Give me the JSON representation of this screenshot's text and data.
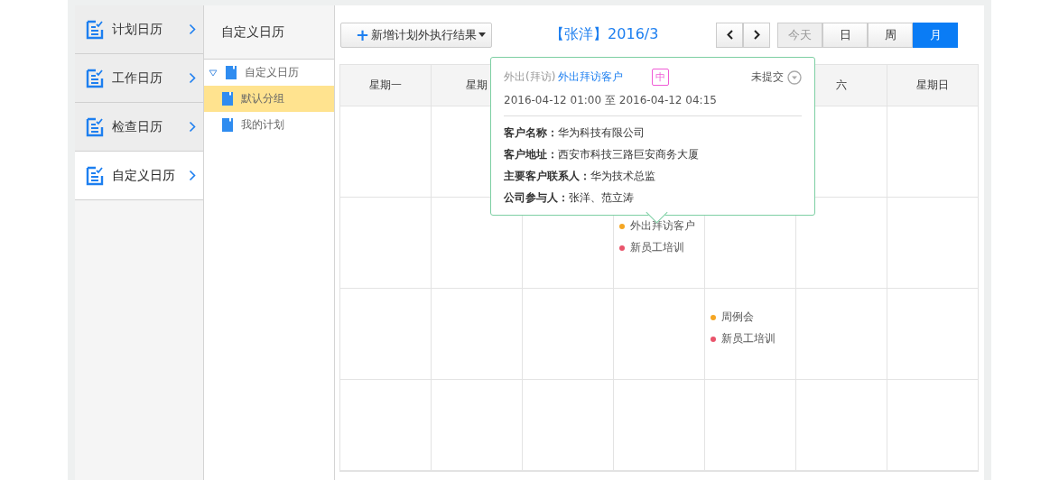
{
  "nav": {
    "items": [
      {
        "label": "计划日历",
        "selected": false
      },
      {
        "label": "工作日历",
        "selected": false
      },
      {
        "label": "检查日历",
        "selected": false
      },
      {
        "label": "自定义日历",
        "selected": true
      }
    ]
  },
  "tree": {
    "title": "自定义日历",
    "items": [
      {
        "label": "自定义日历",
        "expanded": true,
        "selected": false,
        "children": [
          {
            "label": "默认分组",
            "selected": true
          },
          {
            "label": "我的计划",
            "selected": false
          }
        ]
      }
    ]
  },
  "toolbar": {
    "add_button": "新增计划外执行结果",
    "add_icon": "+",
    "title": "【张洋】2016/3",
    "views": [
      {
        "label": "今天",
        "selected": false,
        "disabled": true
      },
      {
        "label": "日",
        "selected": false,
        "disabled": false
      },
      {
        "label": "周",
        "selected": false,
        "disabled": false
      },
      {
        "label": "月",
        "selected": true,
        "disabled": false
      }
    ]
  },
  "calendar": {
    "columns": [
      {
        "label": "星期一"
      },
      {
        "label": "星期"
      },
      {},
      {},
      {},
      {
        "label": "六"
      },
      {
        "label": "星期日"
      }
    ],
    "row_2": {
      "column_4": [
        {
          "title": "外出拜访客户",
          "color": "#f5a623"
        },
        {
          "title": "新员工培训",
          "color": "#e9546b"
        }
      ]
    },
    "row_3": {
      "column_5": [
        {
          "title": "周例会",
          "color": "#f5a623"
        },
        {
          "title": "新员工培训",
          "color": "#e9546b"
        }
      ]
    }
  },
  "popover": {
    "type": "外出(拜访)",
    "link": "外出拜访客户",
    "priority": "中",
    "status": "未提交",
    "time": "2016-04-12 01:00 至 2016-04-12 04:15",
    "details": [
      {
        "label": "客户名称：",
        "value": "华为科技有限公司"
      },
      {
        "label": "客户地址：",
        "value": "西安市科技三路巨安商务大厦"
      },
      {
        "label": "主要客户联系人：",
        "value": "华为技术总监"
      },
      {
        "label": "公司参与人：",
        "value": "张洋、范立涛"
      }
    ]
  }
}
